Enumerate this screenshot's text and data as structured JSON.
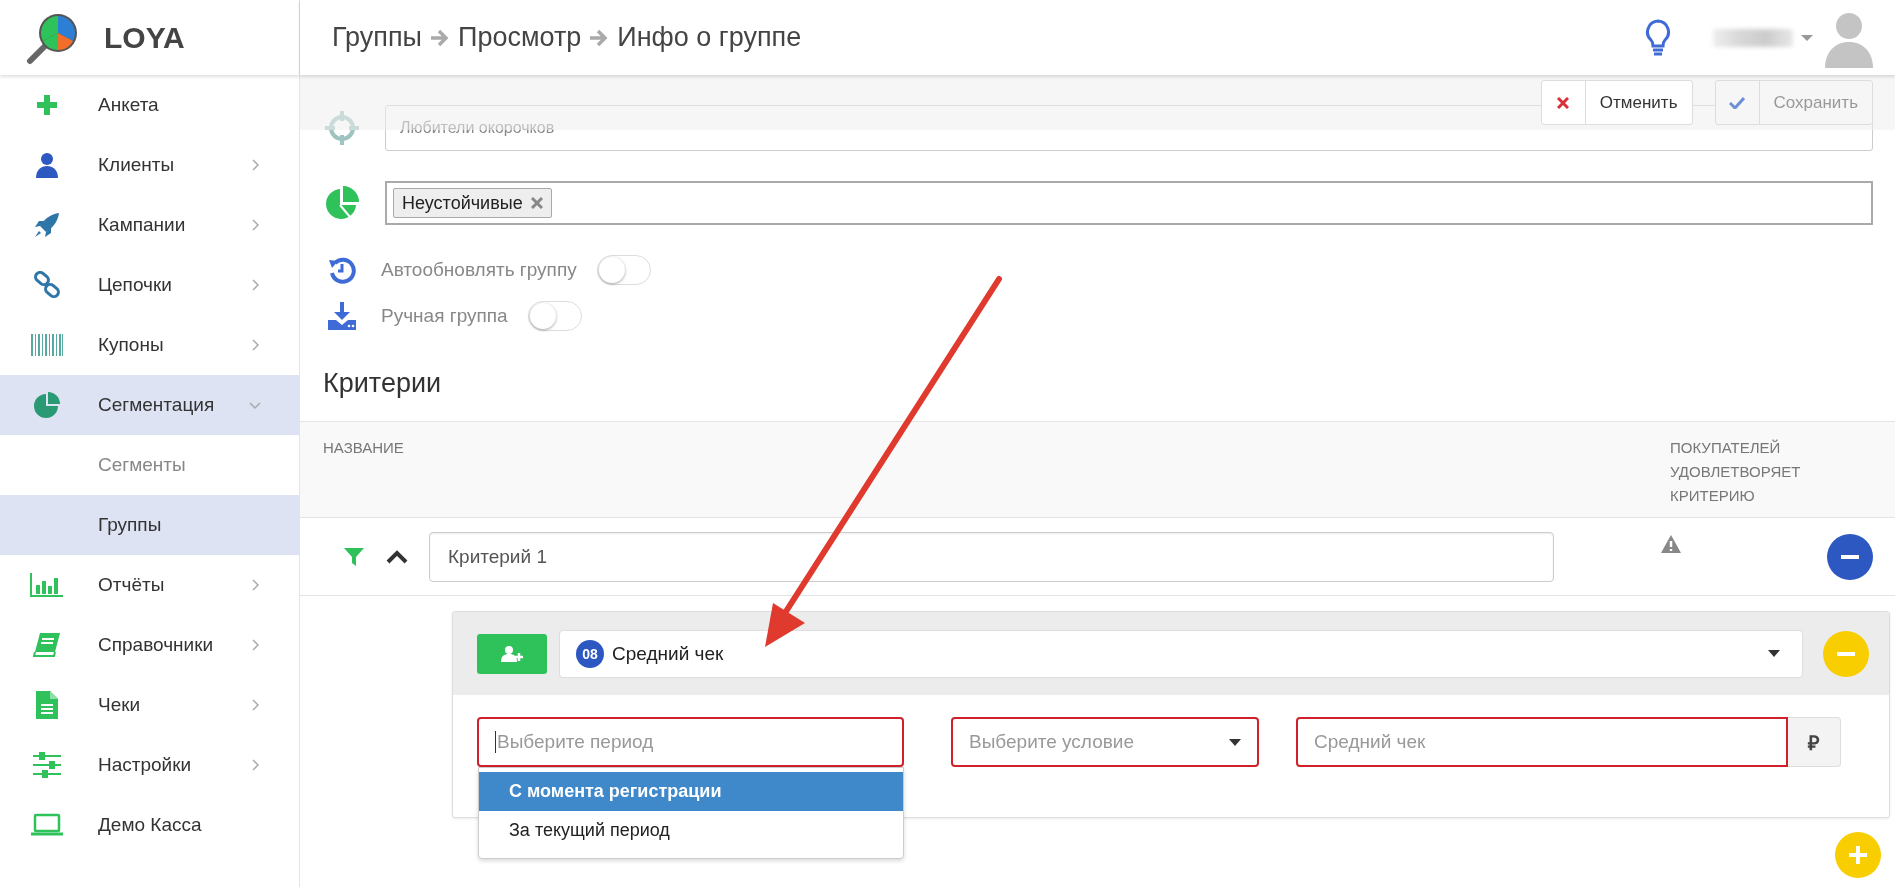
{
  "app": {
    "logo_text": "LOYA"
  },
  "sidebar": {
    "items": [
      {
        "label": "Анкета",
        "has_submenu": false,
        "selected": false
      },
      {
        "label": "Клиенты",
        "has_submenu": true,
        "expanded": false,
        "selected": false
      },
      {
        "label": "Кампании",
        "has_submenu": true,
        "expanded": false,
        "selected": false
      },
      {
        "label": "Цепочки",
        "has_submenu": true,
        "expanded": false,
        "selected": false
      },
      {
        "label": "Купоны",
        "has_submenu": true,
        "expanded": false,
        "selected": false
      },
      {
        "label": "Сегментация",
        "has_submenu": true,
        "expanded": true,
        "selected": true,
        "children": [
          {
            "label": "Сегменты",
            "selected": false
          },
          {
            "label": "Группы",
            "selected": true
          }
        ]
      },
      {
        "label": "Отчёты",
        "has_submenu": true,
        "expanded": false,
        "selected": false
      },
      {
        "label": "Справочники",
        "has_submenu": true,
        "expanded": false,
        "selected": false
      },
      {
        "label": "Чеки",
        "has_submenu": true,
        "expanded": false,
        "selected": false
      },
      {
        "label": "Настройки",
        "has_submenu": true,
        "expanded": false,
        "selected": false
      },
      {
        "label": "Демо Касса",
        "has_submenu": false,
        "selected": false
      }
    ]
  },
  "header": {
    "breadcrumbs": [
      "Группы",
      "Просмотр",
      "Инфо о группе"
    ]
  },
  "toolbar": {
    "buttons": [
      {
        "label": "Отменить",
        "kind": "cancel",
        "disabled": false
      },
      {
        "label": "Сохранить",
        "kind": "save",
        "disabled": true
      }
    ]
  },
  "form": {
    "name_value": "Любители окорочков",
    "segment_tags": [
      "Неустойчивые"
    ],
    "toggles": [
      {
        "label": "Автообновлять группу",
        "on": false
      },
      {
        "label": "Ручная группа",
        "on": false
      }
    ]
  },
  "criteria": {
    "title": "Критерии",
    "columns": [
      "НАЗВАНИЕ",
      "ПОКУПАТЕЛЕЙ УДОВЛЕТВОРЯЕТ КРИТЕРИЮ"
    ],
    "rows": [
      {
        "name": "Критерий 1",
        "expanded": true,
        "conditions": [
          {
            "badge": "08",
            "metric": "Средний чек",
            "period": {
              "placeholder": "Выберите период",
              "invalid": true,
              "options": [
                {
                  "label": "С момента регистрации",
                  "selected": true
                },
                {
                  "label": "За текущий период",
                  "selected": false
                }
              ]
            },
            "condition": {
              "placeholder": "Выберите условие",
              "invalid": true
            },
            "value": {
              "placeholder": "Средний чек",
              "invalid": true,
              "unit": "₽"
            }
          }
        ]
      }
    ]
  }
}
